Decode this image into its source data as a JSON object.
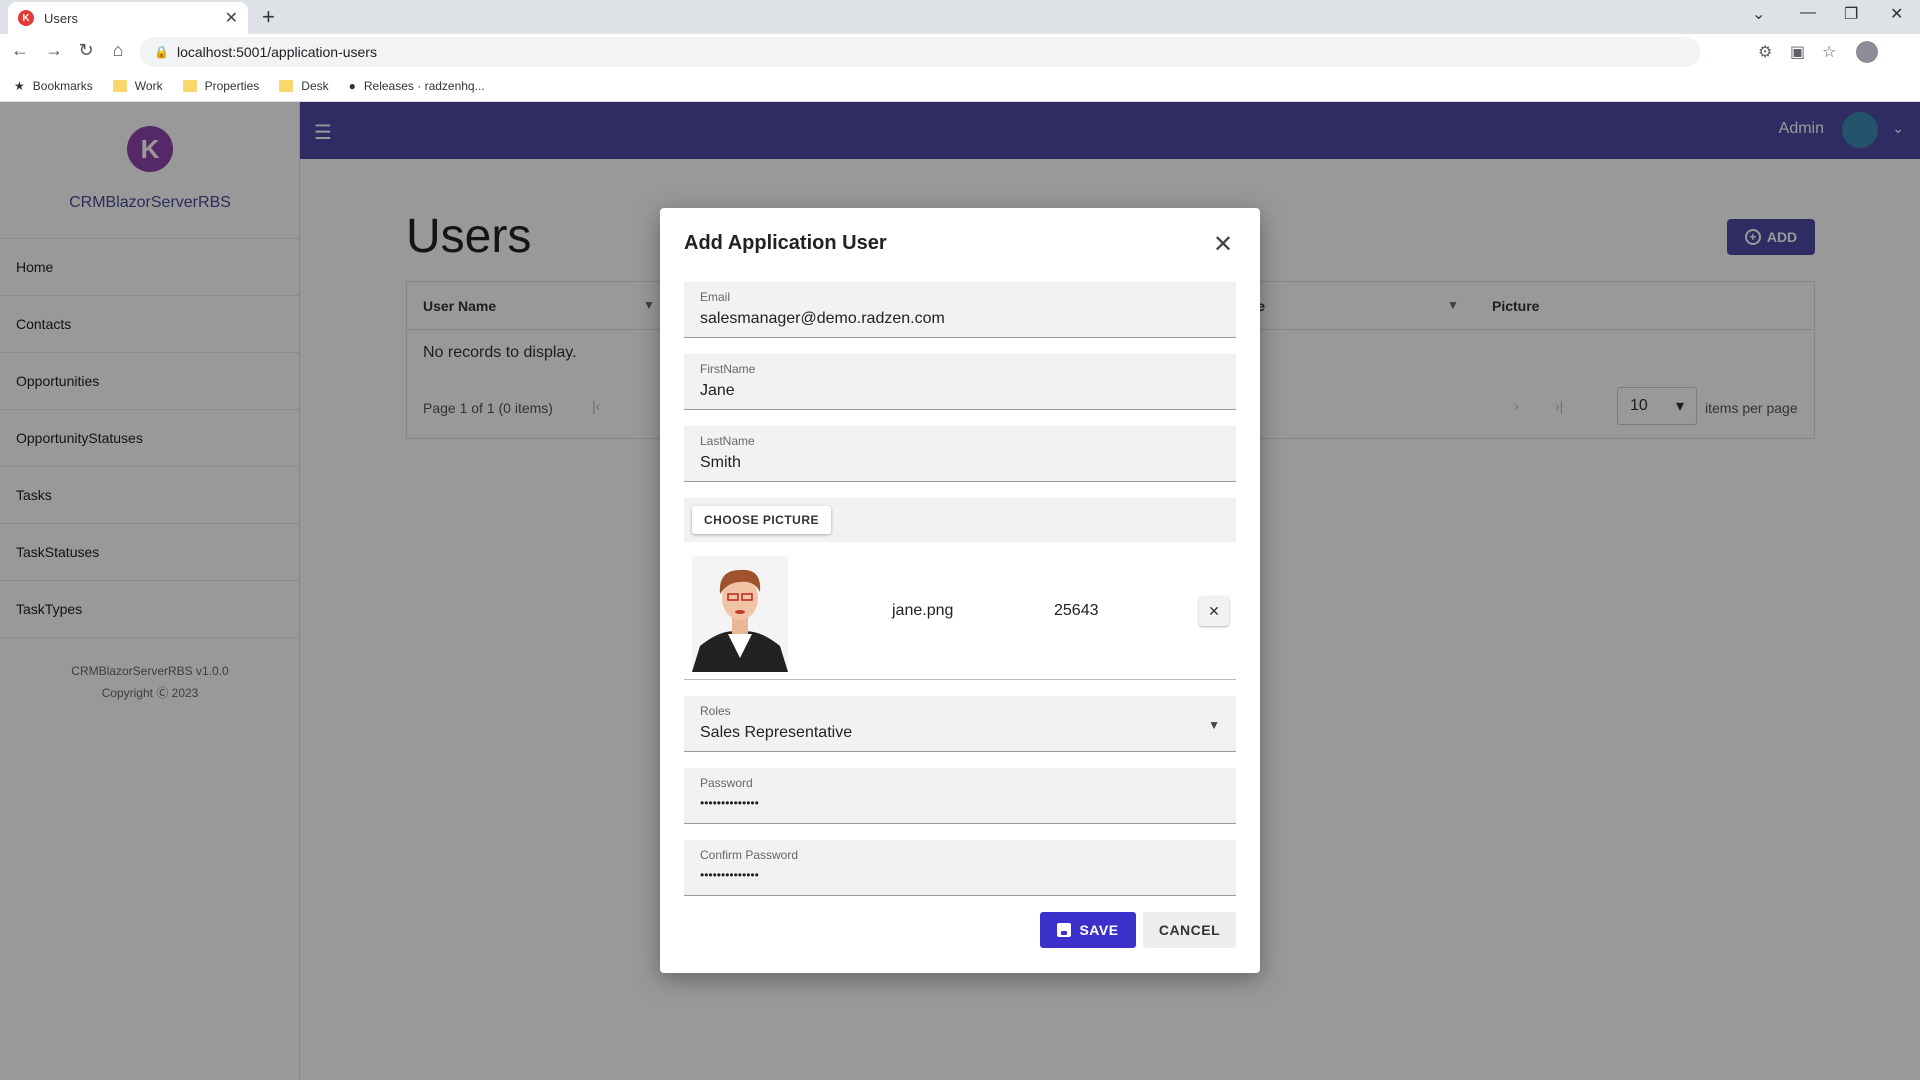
{
  "browser": {
    "tab_title": "Users",
    "tab_favicon_letter": "K",
    "url": "localhost:5001/application-users",
    "bookmarks": [
      "Bookmarks",
      "Work",
      "Properties",
      "Desk",
      "Releases · radzenhq..."
    ]
  },
  "app": {
    "logo_letter": "K",
    "name": "CRMBlazorServerRBS",
    "nav": [
      "Home",
      "Contacts",
      "Opportunities",
      "OpportunityStatuses",
      "Tasks",
      "TaskStatuses",
      "TaskTypes"
    ],
    "footer_version": "CRMBlazorServerRBS v1.0.0",
    "footer_copyright": "Copyright Ⓒ 2023",
    "user": "Admin"
  },
  "page": {
    "title": "Users",
    "add_label": "ADD",
    "columns": [
      "User Name",
      "ame",
      "Picture"
    ],
    "empty_text": "No records to display.",
    "pager_text": "Page 1 of 1 (0 items)",
    "page_size": "10",
    "items_per_page": "items per page"
  },
  "dialog": {
    "title": "Add Application User",
    "email_label": "Email",
    "email_value": "salesmanager@demo.radzen.com",
    "firstname_label": "FirstName",
    "firstname_value": "Jane",
    "lastname_label": "LastName",
    "lastname_value": "Smith",
    "choose_picture": "CHOOSE PICTURE",
    "file_name": "jane.png",
    "file_size": "25643",
    "roles_label": "Roles",
    "roles_value": "Sales Representative",
    "password_label": "Password",
    "password_value": "••••••••••••••",
    "confirm_label": "Confirm Password",
    "confirm_value": "••••••••••••••",
    "save_label": "SAVE",
    "cancel_label": "CANCEL"
  },
  "colors": {
    "header": "#4e4aa3",
    "primary_button": "#3b30c9",
    "logo": "#8e44ad"
  }
}
